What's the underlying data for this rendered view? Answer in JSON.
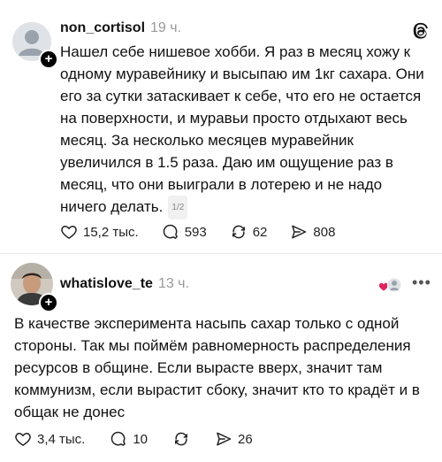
{
  "post1": {
    "username": "non_cortisol",
    "time": "19 ч.",
    "text": "Нашел себе нишевое хобби. Я раз в месяц хожу к одному муравейнику и высыпаю им 1кг сахара. Они его за сутки затаскивает к себе, что его не остается на поверхности, и муравьи просто отдыхают весь месяц. За несколько месяцев муравейник увеличился в 1.5 раза. Даю им ощущение раз в месяц, что они выиграли в лотерею и не надо ничего делать.",
    "page_counter": "1/2",
    "likes": "15,2 тыс.",
    "comments": "593",
    "reposts": "62",
    "shares": "808",
    "icons": [
      "threads-logo-icon",
      "heart-icon",
      "comment-icon",
      "repost-icon",
      "share-icon"
    ]
  },
  "post2": {
    "username": "whatislove_te",
    "time": "13 ч.",
    "text": "В качестве эксперимента насыпь сахар только с одной стороны. Так мы поймём равномерность распределения ресурсов в общине. Если вырасте вверх, значит там коммунизм, если вырастит сбоку, значит кто то крадёт и в общак не донес",
    "likes": "3,4 тыс.",
    "comments": "10",
    "shares": "26"
  },
  "colors": {
    "accent_heart": "#e0245e",
    "muted": "#9a9a9a"
  }
}
